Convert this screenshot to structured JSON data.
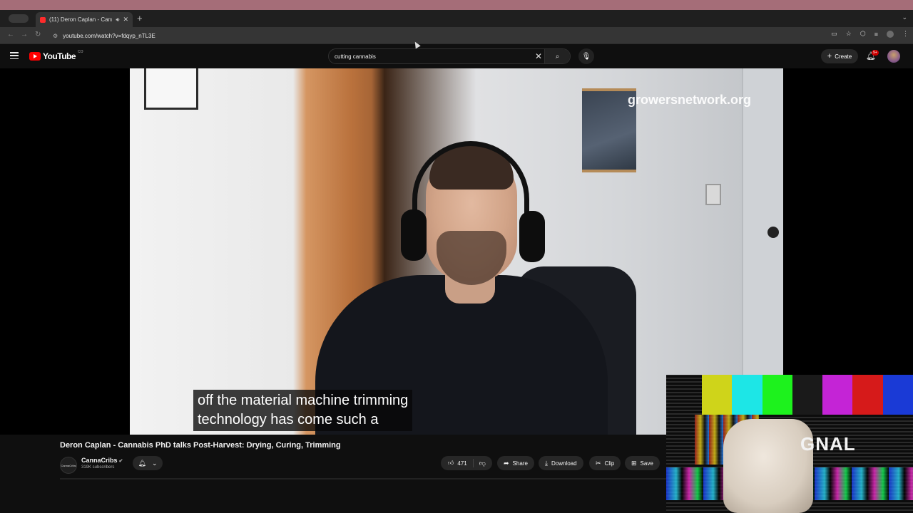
{
  "browser": {
    "tab_title": "(11) Deron Caplan - Cann",
    "url": "youtube.com/watch?v=fdqyp_nTL3E"
  },
  "youtube": {
    "logo_text": "YouTube",
    "logo_country": "CO",
    "search_query": "cutting cannabis",
    "create_label": "Create",
    "notification_count": "9+"
  },
  "video": {
    "watermark": "growersnetwork.org",
    "caption_lines": [
      "off the material machine trimming",
      "technology has come such a"
    ],
    "title": "Deron Caplan - Cannabis PhD talks Post-Harvest: Drying, Curing, Trimming"
  },
  "channel": {
    "avatar_text": "CannaCribs",
    "name": "CannaCribs",
    "subscribers": "319K subscribers"
  },
  "actions": {
    "likes": "471",
    "share": "Share",
    "download": "Download",
    "clip": "Clip",
    "save": "Save"
  },
  "overlay": {
    "text": "GNAL",
    "bar_colors": [
      "#cfd41a",
      "#1de6e6",
      "#1df21d",
      "#1a1a1a",
      "#c424d6",
      "#d61a1a",
      "#1a3ad6"
    ]
  },
  "icons": {
    "like": "thumbs-up-icon",
    "dislike": "thumbs-down-icon",
    "share": "share-arrow-icon",
    "download": "download-icon",
    "clip": "scissors-icon",
    "save": "bookmark-icon"
  }
}
